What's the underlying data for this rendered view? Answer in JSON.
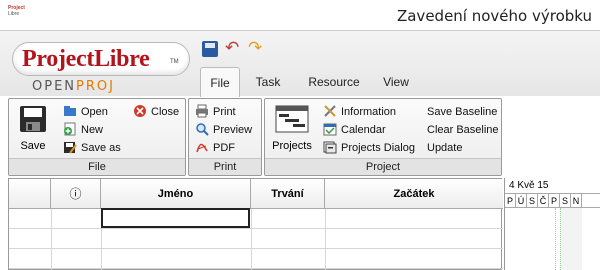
{
  "window": {
    "title": "Zavedení nového výrobku",
    "icon_lines": [
      "Project",
      "Libre"
    ]
  },
  "logo": {
    "brand": "ProjectLibre",
    "tm": "TM",
    "sub_prefix": "OPEN",
    "sub_suffix": "PROJ"
  },
  "quick_access": {
    "icons": [
      "save-icon",
      "undo-icon",
      "redo-icon"
    ]
  },
  "tabs": [
    {
      "label": "File",
      "active": true
    },
    {
      "label": "Task",
      "active": false
    },
    {
      "label": "Resource",
      "active": false
    },
    {
      "label": "View",
      "active": false
    }
  ],
  "ribbon": {
    "file_group": {
      "label": "File",
      "save": "Save",
      "open": "Open",
      "close": "Close",
      "new": "New",
      "save_as": "Save as"
    },
    "print_group": {
      "label": "Print",
      "print": "Print",
      "preview": "Preview",
      "pdf": "PDF"
    },
    "project_group": {
      "label": "Project",
      "projects": "Projects",
      "information": "Information",
      "calendar": "Calendar",
      "projects_dialog": "Projects Dialog",
      "save_baseline": "Save Baseline",
      "clear_baseline": "Clear Baseline",
      "update": "Update"
    }
  },
  "grid": {
    "columns": [
      "",
      "ⓘ",
      "Jméno",
      "Trvání",
      "Začátek"
    ]
  },
  "gantt": {
    "week_label": "4 Kvě 15",
    "days": [
      "P",
      "Ú",
      "S",
      "Č",
      "P",
      "S",
      "N"
    ]
  }
}
